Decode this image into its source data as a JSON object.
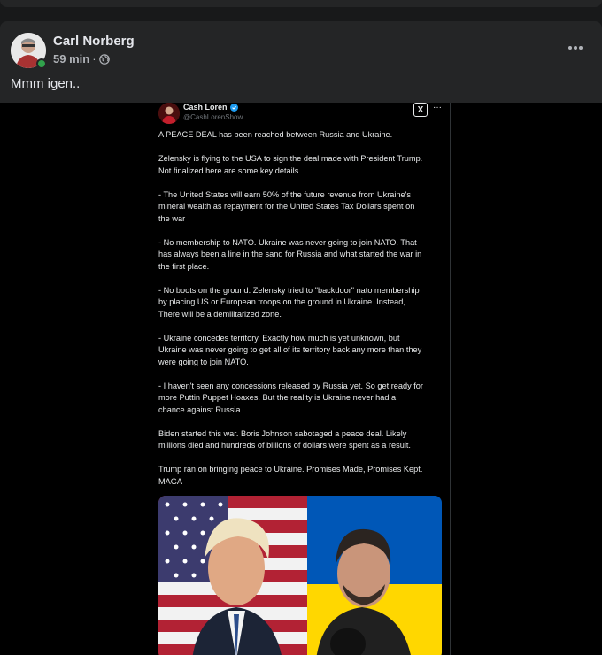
{
  "post": {
    "author": "Carl Norberg",
    "time": "59 min",
    "separator": "·",
    "text": "Mmm igen.."
  },
  "tweet": {
    "name": "Cash Loren",
    "handle": "@CashLorenShow",
    "logo": "X",
    "more": "···",
    "paragraphs": [
      "A PEACE DEAL has been reached between Russia and Ukraine.",
      "Zelensky is flying to the USA to sign the deal made with President Trump.\nNot finalized here are some key details.",
      "- The United States will earn 50% of the future revenue from Ukraine's\nmineral wealth as repayment for the United States Tax Dollars spent on\nthe war",
      "- No membership to NATO. Ukraine was never going to join NATO. That\nhas always been a line in the sand for Russia and what started the war in\nthe first place.",
      "- No boots on the ground. Zelensky tried to \"backdoor\" nato membership\nby placing US or European troops on the ground in Ukraine. Instead,\nThere will be a demilitarized zone.",
      "- Ukraine concedes territory. Exactly how much is yet unknown, but\nUkraine was never going to get all of its territory back any more than they\nwere going to join NATO.",
      "- I haven't seen any concessions released by Russia yet. So get ready for\nmore Puttin Puppet Hoaxes. But the reality is Ukraine never had a\nchance against Russia.",
      "Biden started this war. Boris Johnson sabotaged a peace deal. Likely\nmillions died and hundreds of billions of dollars were spent as a result.",
      "Trump ran on bringing peace to Ukraine. Promises Made, Promises Kept.\nMAGA"
    ]
  },
  "icons": {
    "globe": "globe-icon",
    "more": "more-options-icon",
    "verified": "verified-badge-icon",
    "x": "x-logo-icon"
  },
  "colors": {
    "card_bg": "#242526",
    "online": "#31a24c",
    "verified": "#1d9bf0",
    "flag_blue": "#0057b7",
    "flag_yellow": "#ffd700"
  }
}
